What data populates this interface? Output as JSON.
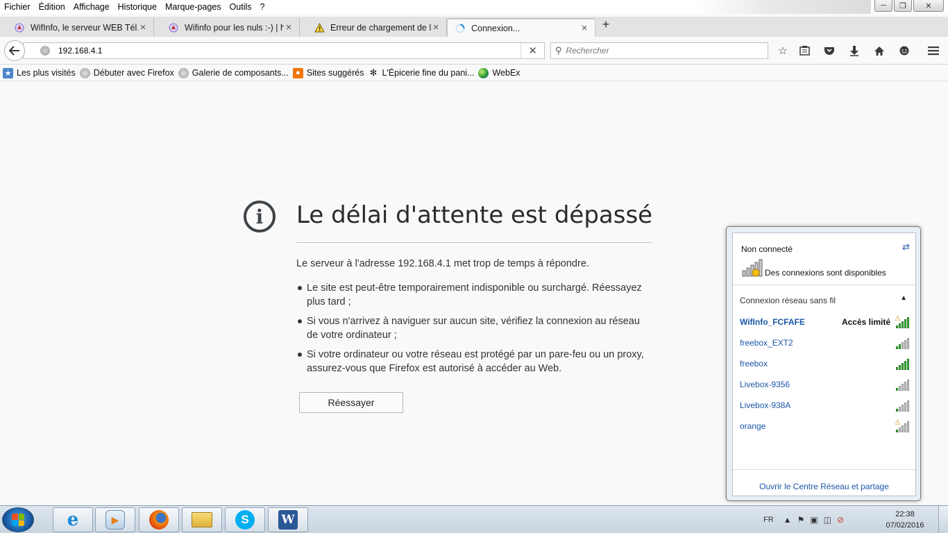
{
  "browser": {
    "menu": [
      "Fichier",
      "Édition",
      "Affichage",
      "Historique",
      "Marque-pages",
      "Outils",
      "?"
    ],
    "menu_access_keys": [
      "F",
      "É",
      "A",
      "H",
      "M",
      "O",
      "?"
    ],
    "tabs": [
      {
        "label": "WifInfo, le serveur WEB Tél...",
        "icon": "wifinfo-favicon"
      },
      {
        "label": "Wifinfo pour les nuls :-) | h...",
        "icon": "wifinfo-favicon"
      },
      {
        "label": "Erreur de chargement de la...",
        "icon": "warning-icon"
      },
      {
        "label": "Connexion...",
        "icon": "loading-spinner-icon",
        "active": true
      }
    ],
    "url": "192.168.4.1",
    "search_placeholder": "Rechercher",
    "bookmarks": [
      {
        "label": "Les plus visités",
        "icon": "bookmark-folder-icon"
      },
      {
        "label": "Débuter avec Firefox",
        "icon": "globe-icon"
      },
      {
        "label": "Galerie de composants...",
        "icon": "globe-icon"
      },
      {
        "label": "Sites suggérés",
        "icon": "suggested-sites-icon"
      },
      {
        "label": "L'Épicerie fine du pani...",
        "icon": "epicerie-favicon"
      },
      {
        "label": "WebEx",
        "icon": "webex-icon"
      }
    ]
  },
  "error_page": {
    "title": "Le délai d'attente est dépassé",
    "description": "Le serveur à l'adresse 192.168.4.1 met trop de temps à répondre.",
    "bullets": [
      "Le site est peut-être temporairement indisponible ou surchargé. Réessayez plus tard ;",
      "Si vous n'arrivez à naviguer sur aucun site, vérifiez la connexion au réseau de votre ordinateur ;",
      "Si votre ordinateur ou votre réseau est protégé par un pare-feu ou un proxy, assurez-vous que Firefox est autorisé à accéder au Web."
    ],
    "retry_label": "Réessayer"
  },
  "wifi_panel": {
    "status": "Non connecté",
    "available": "Des connexions sont disponibles",
    "section": "Connexion réseau sans fil",
    "networks": [
      {
        "name": "WifInfo_FCFAFE",
        "status": "Accès limité",
        "signal": 5,
        "secured": false,
        "warning": true
      },
      {
        "name": "freebox_EXT2",
        "status": "",
        "signal": 2,
        "secured": false,
        "warning": false
      },
      {
        "name": "freebox",
        "status": "",
        "signal": 5,
        "secured": false,
        "warning": false
      },
      {
        "name": "Livebox-9356",
        "status": "",
        "signal": 1,
        "secured": false,
        "warning": false
      },
      {
        "name": "Livebox-938A",
        "status": "",
        "signal": 1,
        "secured": false,
        "warning": false
      },
      {
        "name": "orange",
        "status": "",
        "signal": 1,
        "secured": false,
        "warning": true
      }
    ],
    "footer": "Ouvrir le Centre Réseau et partage"
  },
  "taskbar": {
    "apps": [
      "internet-explorer-icon",
      "media-player-icon",
      "firefox-icon",
      "file-explorer-icon",
      "skype-icon",
      "word-icon"
    ],
    "language": "FR",
    "time": "22:38",
    "date": "07/02/2016"
  },
  "colors": {
    "link_blue": "#1a56a6",
    "signal_green": "#3bbb3b",
    "page_bg": "#f9f9fa"
  }
}
